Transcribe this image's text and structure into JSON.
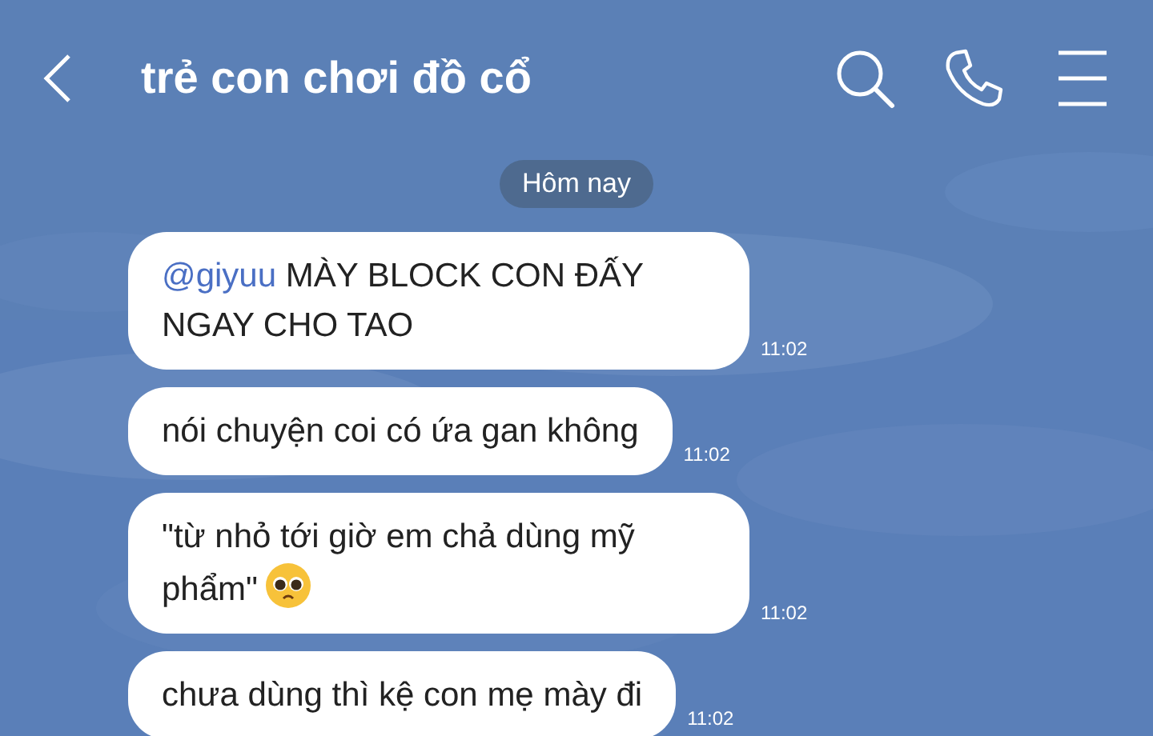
{
  "header": {
    "title": "trẻ con chơi đồ cổ"
  },
  "date_separator": "Hôm nay",
  "messages": [
    {
      "mention": "@giyuu",
      "text": "MÀY BLOCK CON ĐẤY NGAY CHO TAO",
      "trailing_emoji": false,
      "time": "11:02"
    },
    {
      "text": "nói chuyện coi có ứa gan không",
      "trailing_emoji": false,
      "time": "11:02"
    },
    {
      "text": "\"từ nhỏ tới giờ em chả dùng mỹ phẩm\"",
      "trailing_emoji": true,
      "time": "11:02"
    },
    {
      "text": "chưa dùng thì kệ con mẹ mày đi",
      "trailing_emoji": false,
      "time": "11:02"
    }
  ]
}
